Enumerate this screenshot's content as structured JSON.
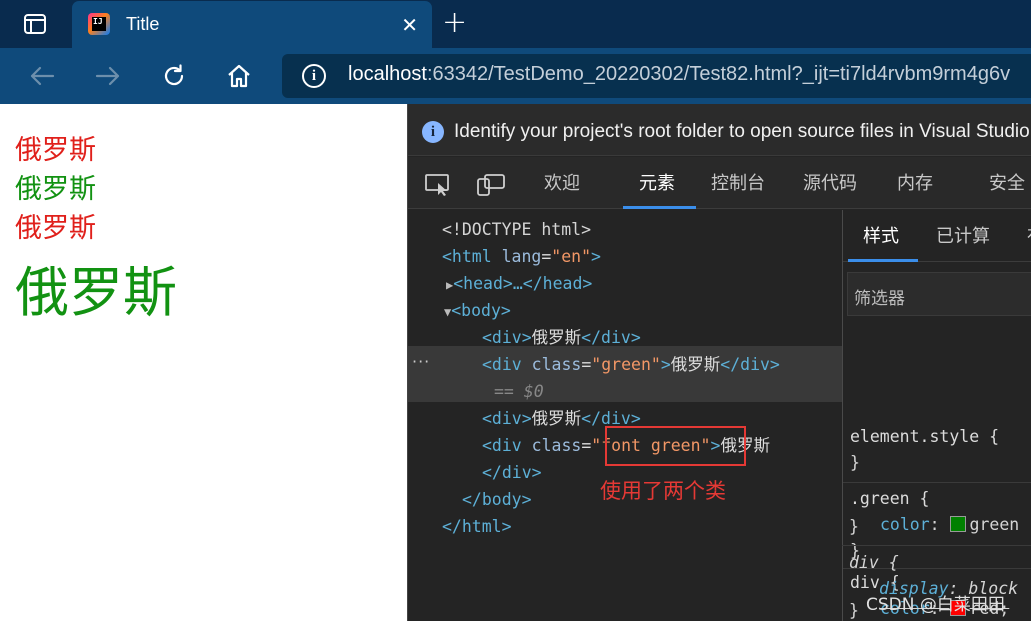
{
  "browser": {
    "tab_title": "Title",
    "tab_icon_text": "IJ",
    "url_host": "localhost",
    "url_rest": ":63342/TestDemo_20220302/Test82.html?_ijt=ti7ld4rvbm9rm4g6v"
  },
  "page": {
    "lines": [
      {
        "text": "俄罗斯",
        "color": "#e0201b"
      },
      {
        "text": "俄罗斯",
        "color": "#129212"
      },
      {
        "text": "俄罗斯",
        "color": "#e0201b"
      },
      {
        "text": "俄罗斯",
        "color": "#129212"
      }
    ]
  },
  "devtools": {
    "banner": "Identify your project's root folder to open source files in Visual Studio",
    "tabs": [
      "欢迎",
      "元素",
      "控制台",
      "源代码",
      "内存",
      "安全"
    ],
    "active_tab": "元素",
    "dom": {
      "doctype": "<!DOCTYPE html>",
      "html_open_tag": "<html ",
      "html_attr": "lang",
      "html_attr_val": "\"en\"",
      "html_close_bracket": ">",
      "head": "<head>…</head>",
      "body_open": "<body>",
      "div_open": "<div>",
      "div_close": "</div>",
      "div_class_open": "<div ",
      "class_attr": "class",
      "green_val": "\"green\"",
      "font_green_val": "\"font green\"",
      "gt": ">",
      "eq_sign": "=",
      "text": "俄罗斯",
      "selected_marker": "== $0",
      "body_close": "</body>",
      "html_close": "</html>",
      "ellipsis": "···"
    },
    "annotation": "使用了两个类",
    "styles": {
      "tabs": [
        "样式",
        "已计算",
        "布"
      ],
      "filter_placeholder": "筛选器",
      "element_style": "element.style {",
      "close_brace": "}",
      "green_selector": ".green {",
      "color_prop": "color",
      "green_value": "green",
      "div_selector": "div {",
      "red_value": "red;",
      "display_prop": "display",
      "block_value": "block",
      "green_hex": "#008000",
      "red_hex": "#ff0000"
    }
  },
  "watermark": "CSDN @白菜田田"
}
